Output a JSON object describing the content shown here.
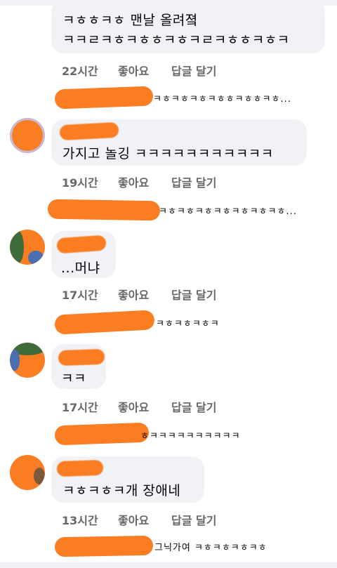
{
  "comments": [
    {
      "text_line1": "ㅋㅎㅎㅋㅎ 맨날 올려졐",
      "text_line2": "ㅋㅋㄹㅋㅎㅋㅎㅎㅋㅎㅋㄹㅋㅎㅎㅋㅎㅋ",
      "time": "22시간",
      "like": "좋아요",
      "reply": "답글 달기",
      "reply_preview": "ㅋㅎㅋㅎㅋㅎㅋㅎㅎㅋㅎㅎㅋㅎ..."
    },
    {
      "text": "가지고 놀깅 ㅋㅋㅋㅋㅋㅋㅋㅋㅋㅋㅋ",
      "time": "19시간",
      "like": "좋아요",
      "reply": "답글 달기",
      "reply_preview": "ㅋㅎㅋㅎㅋㅎㅋㅎㅋㅎㅋㅎㅋㅎ..."
    },
    {
      "text": "...머냐",
      "time": "17시간",
      "like": "좋아요",
      "reply": "답글 달기",
      "reply_preview": "ㅋㅎㅋㅎㅋㅎㅋ"
    },
    {
      "text": "ㅋㅋ",
      "time": "17시간",
      "like": "좋아요",
      "reply": "답글 달기",
      "reply_preview": "ㅎㅋㅋㅋㅋㅋㅋㅋㅋㅋㅋ"
    },
    {
      "text": "ㅋㅎㅋㅎㅋ개 장애네",
      "time": "13시간",
      "like": "좋아요",
      "reply": "답글 달기",
      "reply_preview": "그닉가여 ㅋㅎㅋㅎㅋㅎㅋㅎ"
    }
  ],
  "colors": {
    "bubble": "#f0f2f5",
    "meta": "#65676b",
    "redaction": "#fb7d22"
  }
}
